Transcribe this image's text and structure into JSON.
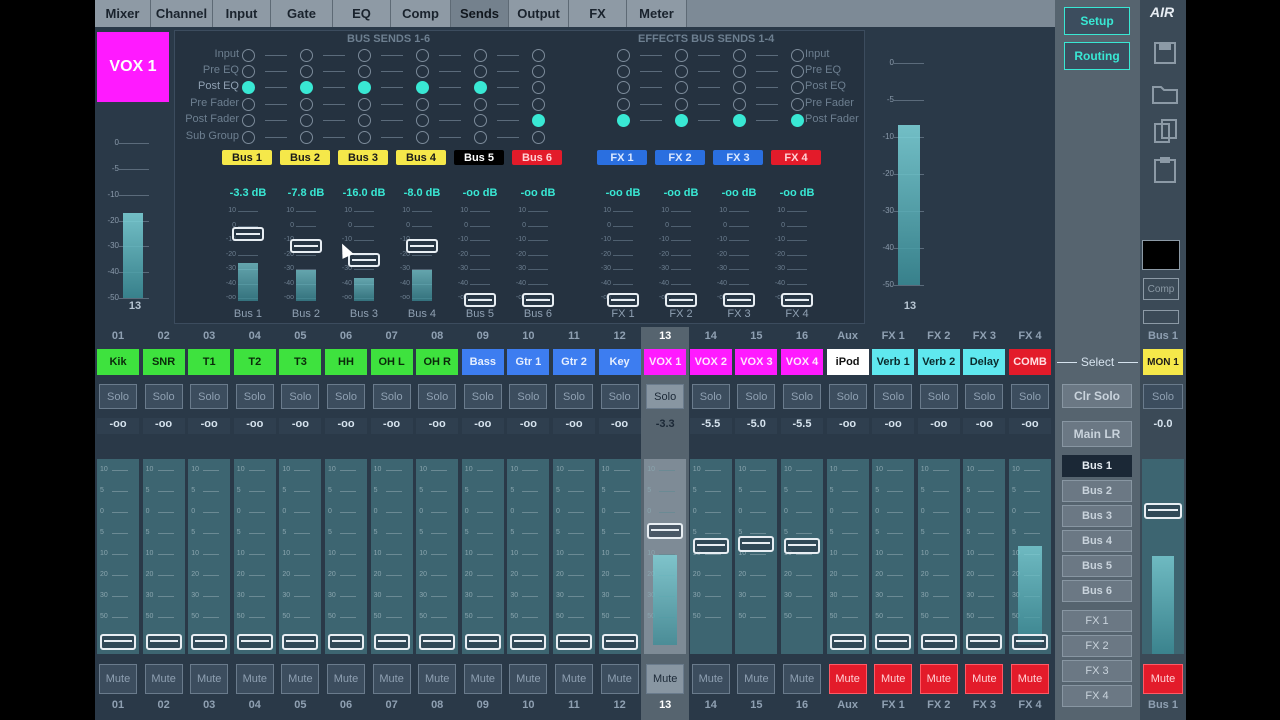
{
  "nav": {
    "tabs": [
      "Mixer",
      "Channel",
      "Input",
      "Gate",
      "EQ",
      "Comp",
      "Sends",
      "Output",
      "FX",
      "Meter"
    ],
    "active": "Sends"
  },
  "channel": {
    "label": "VOX 1",
    "number": "13"
  },
  "leftMeter": {
    "scale": [
      "0",
      "-5",
      "-10",
      "-20",
      "-30",
      "-40",
      "-50"
    ],
    "level": 0.55,
    "label": "13"
  },
  "busSends": {
    "title": "BUS SENDS 1-6",
    "taps": [
      "Input",
      "Pre EQ",
      "Post EQ",
      "Pre Fader",
      "Post Fader",
      "Sub Group"
    ],
    "buses": [
      {
        "name": "Bus 1",
        "db": "-3.3 dB",
        "tap": 2,
        "level": 0.55,
        "color": "#f5e84a",
        "text": "#1a1a1a",
        "label": "Bus 1"
      },
      {
        "name": "Bus 2",
        "db": "-7.8 dB",
        "tap": 2,
        "level": 0.45,
        "color": "#f5e84a",
        "text": "#1a1a1a",
        "label": "Bus 2"
      },
      {
        "name": "Bus 3",
        "db": "-16.0 dB",
        "tap": 2,
        "level": 0.33,
        "color": "#f5e84a",
        "text": "#1a1a1a",
        "label": "Bus 3"
      },
      {
        "name": "Bus 4",
        "db": "-8.0 dB",
        "tap": 2,
        "level": 0.45,
        "color": "#f5e84a",
        "text": "#1a1a1a",
        "label": "Bus 4"
      },
      {
        "name": "Bus 5",
        "db": "-oo dB",
        "tap": 2,
        "level": 0,
        "color": "#000000",
        "text": "#ffffff",
        "label": "Bus 5"
      },
      {
        "name": "Bus 6",
        "db": "-oo dB",
        "tap": 4,
        "level": 0,
        "color": "#e31b2a",
        "text": "#ffd2d6",
        "label": "Bus 6"
      }
    ]
  },
  "fxSends": {
    "title": "EFFECTS BUS SENDS 1-4",
    "taps": [
      "Input",
      "Pre EQ",
      "Post EQ",
      "Pre Fader",
      "Post Fader"
    ],
    "buses": [
      {
        "name": "FX 1",
        "db": "-oo dB",
        "tap": 4,
        "color": "#2a6fe0",
        "text": "#dbe8ff",
        "label": "FX 1"
      },
      {
        "name": "FX 2",
        "db": "-oo dB",
        "tap": 4,
        "color": "#2a6fe0",
        "text": "#dbe8ff",
        "label": "FX 2"
      },
      {
        "name": "FX 3",
        "db": "-oo dB",
        "tap": 4,
        "color": "#2a6fe0",
        "text": "#dbe8ff",
        "label": "FX 3"
      },
      {
        "name": "FX 4",
        "db": "-oo dB",
        "tap": 4,
        "color": "#e31b2a",
        "text": "#ffd2d6",
        "label": "FX 4"
      }
    ]
  },
  "faderScale": [
    "10",
    "0",
    "-10",
    "-20",
    "-30",
    "-40",
    "-oo"
  ],
  "rightMeter": {
    "scale": [
      "0",
      "-5",
      "-10",
      "-20",
      "-30",
      "-40",
      "-50"
    ],
    "level": 0.72,
    "label": "13"
  },
  "sidebar": {
    "setup": "Setup",
    "routing": "Routing",
    "select": "Select",
    "clrSolo": "Clr Solo",
    "mainLR": "Main LR",
    "buses": [
      "Bus 1",
      "Bus 2",
      "Bus 3",
      "Bus 4",
      "Bus 5",
      "Bus 6"
    ],
    "fx": [
      "FX 1",
      "FX 2",
      "FX 3",
      "FX 4"
    ],
    "selectedBus": "Bus 1"
  },
  "brand": {
    "logo": "AIR"
  },
  "rightStrip": {
    "comp": "Comp",
    "bus": "Bus 1",
    "name": "MON 1",
    "solo": "Solo",
    "vol": "-0.0",
    "mute": "Mute",
    "level": 0.4
  },
  "strips": [
    {
      "num": "01",
      "name": "Kik",
      "color": "#3ee23e",
      "text": "#0a2a0a",
      "vol": "-oo",
      "mute": false
    },
    {
      "num": "02",
      "name": "SNR",
      "color": "#3ee23e",
      "text": "#0a2a0a",
      "vol": "-oo",
      "mute": false
    },
    {
      "num": "03",
      "name": "T1",
      "color": "#3ee23e",
      "text": "#0a2a0a",
      "vol": "-oo",
      "mute": false
    },
    {
      "num": "04",
      "name": "T2",
      "color": "#3ee23e",
      "text": "#0a2a0a",
      "vol": "-oo",
      "mute": false
    },
    {
      "num": "05",
      "name": "T3",
      "color": "#3ee23e",
      "text": "#0a2a0a",
      "vol": "-oo",
      "mute": false
    },
    {
      "num": "06",
      "name": "HH",
      "color": "#3ee23e",
      "text": "#0a2a0a",
      "vol": "-oo",
      "mute": false
    },
    {
      "num": "07",
      "name": "OH L",
      "color": "#3ee23e",
      "text": "#0a2a0a",
      "vol": "-oo",
      "mute": false
    },
    {
      "num": "08",
      "name": "OH R",
      "color": "#3ee23e",
      "text": "#0a2a0a",
      "vol": "-oo",
      "mute": false
    },
    {
      "num": "09",
      "name": "Bass",
      "color": "#3d7df0",
      "text": "#e6efff",
      "vol": "-oo",
      "mute": false
    },
    {
      "num": "10",
      "name": "Gtr 1",
      "color": "#3d7df0",
      "text": "#e6efff",
      "vol": "-oo",
      "mute": false
    },
    {
      "num": "11",
      "name": "Gtr 2",
      "color": "#3d7df0",
      "text": "#e6efff",
      "vol": "-oo",
      "mute": false
    },
    {
      "num": "12",
      "name": "Key",
      "color": "#3d7df0",
      "text": "#e6efff",
      "vol": "-oo",
      "mute": false
    },
    {
      "num": "13",
      "name": "VOX 1",
      "color": "#ff1aff",
      "text": "#ffe6ff",
      "vol": "-3.3",
      "mute": false,
      "selected": true
    },
    {
      "num": "14",
      "name": "VOX 2",
      "color": "#ff1aff",
      "text": "#ffe6ff",
      "vol": "-5.5",
      "mute": false
    },
    {
      "num": "15",
      "name": "VOX 3",
      "color": "#ff1aff",
      "text": "#ffe6ff",
      "vol": "-5.0",
      "mute": false
    },
    {
      "num": "16",
      "name": "VOX 4",
      "color": "#ff1aff",
      "text": "#ffe6ff",
      "vol": "-5.5",
      "mute": false
    },
    {
      "num": "Aux",
      "name": "iPod",
      "color": "#ffffff",
      "text": "#111111",
      "vol": "-oo",
      "mute": true
    },
    {
      "num": "FX 1",
      "name": "Verb 1",
      "color": "#5fe8ef",
      "text": "#0a2a2c",
      "vol": "-oo",
      "mute": true
    },
    {
      "num": "FX 2",
      "name": "Verb 2",
      "color": "#5fe8ef",
      "text": "#0a2a2c",
      "vol": "-oo",
      "mute": true
    },
    {
      "num": "FX 3",
      "name": "Delay",
      "color": "#5fe8ef",
      "text": "#0a2a2c",
      "vol": "-oo",
      "mute": true
    },
    {
      "num": "FX 4",
      "name": "COMB",
      "color": "#e31b2a",
      "text": "#ffe0e3",
      "vol": "-oo",
      "mute": true
    }
  ],
  "stripLabels": {
    "solo": "Solo",
    "mute": "Mute"
  },
  "stripLevels": [
    0,
    0,
    0,
    0,
    0,
    0,
    0,
    0,
    0,
    0,
    0,
    0,
    0.5,
    0,
    0,
    0,
    0,
    0,
    0,
    0,
    0.55
  ],
  "stripFaders": [
    0,
    0,
    0,
    0,
    0,
    0,
    0,
    0,
    0,
    0,
    0,
    0,
    0.72,
    0.63,
    0.64,
    0.63,
    0,
    0,
    0,
    0,
    0
  ]
}
